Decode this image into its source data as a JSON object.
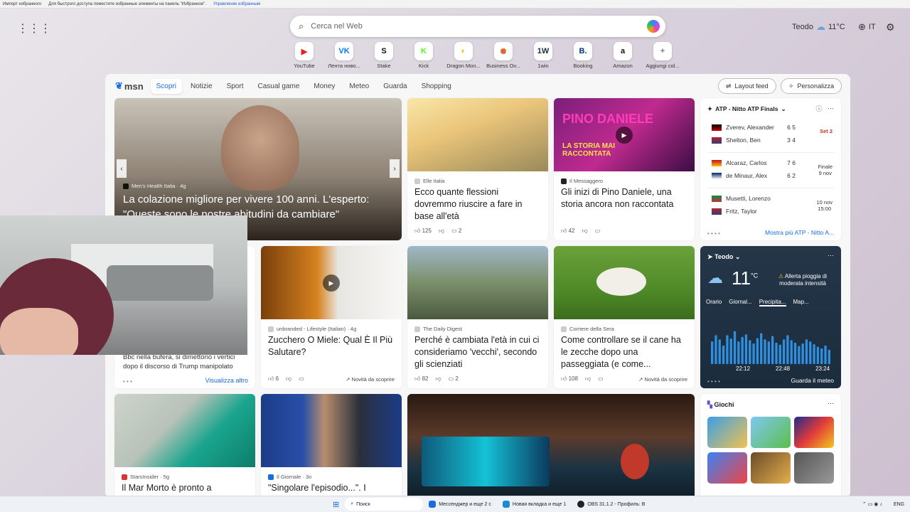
{
  "favbar": {
    "import": "Импорт избранного",
    "hint": "Для быстрого доступа поместите избранные элементы на панель \"Избранное\".",
    "link": "Управление избранным"
  },
  "search": {
    "placeholder": "Cerca nel Web"
  },
  "header": {
    "user": "Teodo",
    "temp": "11°C",
    "lang": "IT"
  },
  "quick_links": [
    {
      "label": "YouTube",
      "icon": "youtube-icon",
      "glyph": "▶",
      "color": "#e62117"
    },
    {
      "label": "Лента ново...",
      "icon": "vk-icon",
      "glyph": "VK",
      "color": "#0077ff"
    },
    {
      "label": "Stake",
      "icon": "stake-icon",
      "glyph": "S",
      "color": "#111"
    },
    {
      "label": "Kick",
      "icon": "kick-icon",
      "glyph": "K",
      "color": "#53fc18"
    },
    {
      "label": "Dragon Mon...",
      "icon": "dragon-icon",
      "glyph": "◐",
      "color": "#e3c400"
    },
    {
      "label": "Business Ov...",
      "icon": "business-icon",
      "glyph": "✺",
      "color": "#d63"
    },
    {
      "label": "1win",
      "icon": "1win-icon",
      "glyph": "1W",
      "color": "#1c2c44"
    },
    {
      "label": "Booking",
      "icon": "booking-icon",
      "glyph": "B.",
      "color": "#003580"
    },
    {
      "label": "Amazon",
      "icon": "amazon-icon",
      "glyph": "a",
      "color": "#111"
    },
    {
      "label": "Aggiungi col...",
      "icon": "add-icon",
      "glyph": "+",
      "color": "#777"
    }
  ],
  "nav": {
    "logo": "msn",
    "tabs": [
      "Scopri",
      "Notizie",
      "Sport",
      "Casual game",
      "Money",
      "Meteo",
      "Guarda",
      "Shopping"
    ],
    "layout": "Layout feed",
    "personalize": "Personalizza"
  },
  "hero": {
    "source": "Men's Health Italia · 4g",
    "title": "La colazione migliore per vivere 100 anni. L'esperto: \"Queste sono le nostre abitudini da cambiare\""
  },
  "cards": {
    "c1": {
      "source": "Elle Italia",
      "title": "Ecco quante flessioni dovremmo riuscire a fare in base all'età",
      "likes": "125",
      "comments": "2"
    },
    "c2": {
      "source": "Il Messaggero",
      "title": "Gli inizi di Pino Daniele, una storia ancora non raccontata",
      "likes": "42",
      "img_text1": "PINO DANIELE",
      "img_text2": "LA STORIA MAI RACCONTATA"
    },
    "c3": {
      "source": "unbranded - Lifestyle (Italian) · 4g",
      "title": "Zucchero O Miele: Qual È Il Più Salutare?",
      "likes": "6",
      "novita": "Novità da scoprire"
    },
    "c4": {
      "source": "The Daily Digest",
      "title": "Perché è cambiata l'età in cui ci consideriamo 'vecchi', secondo gli scienziati",
      "likes": "82",
      "comments": "2"
    },
    "c5": {
      "source": "Corriere della Sera",
      "title": "Come controllare se il cane ha le zecche dopo una passeggiata (e come...",
      "likes": "108",
      "novita": "Novità da scoprire"
    },
    "c6": {
      "partial": "Bbc nella bufera, si dimettono i vertici dopo il discorso di Trump manipolato",
      "more": "Visualizza altro"
    },
    "c7": {
      "source": "StarsInsider · 5g",
      "title": "Il Mar Morto è pronto a"
    },
    "c8": {
      "source": "Il Giornale · 3o",
      "title": "\"Singolare l'episodio...\". I"
    }
  },
  "atp": {
    "title": "ATP - Nitto ATP Finals",
    "more": "Mostra più ATP - Nitto A...",
    "matches": [
      {
        "p1": "Zverev, Alexander",
        "s1": "6 5",
        "p2": "Shelton, Ben",
        "s2": "3 4",
        "status": "Set 2"
      },
      {
        "p1": "Alcaraz, Carlos",
        "s1": "7 6",
        "p2": "de Minaur, Alex",
        "s2": "6 2",
        "status": "Finale",
        "date": "9 nov"
      },
      {
        "p1": "Musetti, Lorenzo",
        "s1": "",
        "p2": "Fritz, Taylor",
        "s2": "",
        "status": "10 nov",
        "date": "15:00"
      }
    ]
  },
  "weather": {
    "location": "Teodo",
    "temp": "11",
    "unit": "°C",
    "alert": "Allerta pioggia di moderata intensità",
    "tabs": [
      "Orario",
      "Giornal...",
      "Precipita...",
      "Map..."
    ],
    "times": [
      "22:12",
      "22:48",
      "23:24"
    ],
    "link": "Guarda il meteo",
    "precip": [
      0.55,
      0.7,
      0.6,
      0.45,
      0.7,
      0.62,
      0.8,
      0.55,
      0.66,
      0.72,
      0.58,
      0.5,
      0.63,
      0.75,
      0.6,
      0.55,
      0.68,
      0.52,
      0.47,
      0.6,
      0.7,
      0.58,
      0.52,
      0.44,
      0.5,
      0.6,
      0.55,
      0.48,
      0.42,
      0.38,
      0.45,
      0.35
    ]
  },
  "games": {
    "title": "Giochi"
  },
  "taskbar": {
    "search": "Поиск",
    "app1": "Мессенджер и еще 2 с",
    "app2": "Новая вкладка и еще 1",
    "app3": "OBS 31.1.2 - Профиль: B",
    "lang": "ENG"
  }
}
